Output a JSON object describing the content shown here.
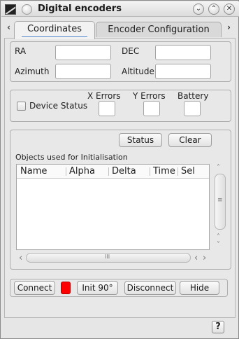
{
  "window": {
    "title": "Digital encoders",
    "controls": {
      "minimize": "⌄",
      "maximize": "⌃",
      "close": "✕"
    }
  },
  "tabs": {
    "left_arrow": "‹",
    "right_arrow": "›",
    "items": [
      {
        "label": "Coordinates",
        "active": true
      },
      {
        "label": "Encoder Configuration",
        "active": false
      }
    ]
  },
  "coordinates": {
    "ra_label": "RA",
    "ra_value": "",
    "dec_label": "DEC",
    "dec_value": "",
    "azimuth_label": "Azimuth",
    "azimuth_value": "",
    "altitude_label": "Altitude",
    "altitude_value": ""
  },
  "status": {
    "device_status_label": "Device Status",
    "x_errors_label": "X Errors",
    "y_errors_label": "Y Errors",
    "battery_label": "Battery"
  },
  "init": {
    "status_button": "Status",
    "clear_button": "Clear",
    "objects_label": "Objects used for Initialisation",
    "columns": [
      "Name",
      "Alpha",
      "Delta",
      "Time",
      "Sel"
    ],
    "rows": []
  },
  "scroll": {
    "up": "˄",
    "down": "˅",
    "left": "‹",
    "right": "›",
    "grip_v": "≡",
    "grip_h": "III"
  },
  "actions": {
    "connect": "Connect",
    "init90": "Init 90°",
    "disconnect": "Disconnect",
    "hide": "Hide"
  },
  "help_button": "?",
  "colors": {
    "status_led": "#ff0000",
    "tab_underline": "#5d8fd0"
  }
}
